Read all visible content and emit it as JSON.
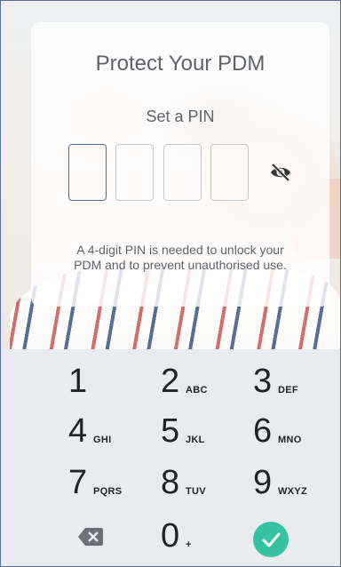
{
  "card": {
    "title": "Protect Your PDM",
    "subtitle": "Set a PIN",
    "pin_boxes": [
      "",
      "",
      "",
      ""
    ],
    "hint_line1": "A 4-digit PIN is needed to unlock your",
    "hint_line2": "PDM and to prevent unauthorised use."
  },
  "keypad": {
    "keys": [
      {
        "num": "1",
        "letters": ""
      },
      {
        "num": "2",
        "letters": "ABC"
      },
      {
        "num": "3",
        "letters": "DEF"
      },
      {
        "num": "4",
        "letters": "GHI"
      },
      {
        "num": "5",
        "letters": "JKL"
      },
      {
        "num": "6",
        "letters": "MNO"
      },
      {
        "num": "7",
        "letters": "PQRS"
      },
      {
        "num": "8",
        "letters": "TUV"
      },
      {
        "num": "9",
        "letters": "WXYZ"
      },
      {
        "num": "0",
        "letters": "+"
      }
    ],
    "icons": {
      "backspace": "backspace-icon",
      "confirm": "check-icon",
      "toggle_visibility": "eye-slash-icon"
    },
    "colors": {
      "accent": "#37c3a3",
      "active_box": "#4b6fa3"
    }
  }
}
